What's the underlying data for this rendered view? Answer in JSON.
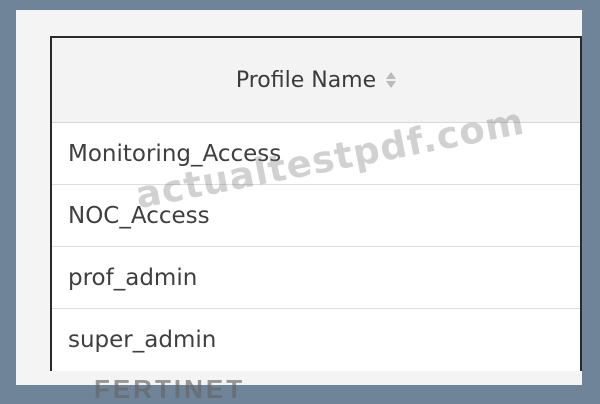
{
  "table": {
    "header": "Profile Name",
    "sort_icon": "sort-updown-icon",
    "rows": [
      "Monitoring_Access",
      "NOC_Access",
      "prof_admin",
      "super_admin"
    ]
  },
  "watermark": "actualtestpdf.com",
  "footer_logo": "FERTINET",
  "colors": {
    "background": "#6f8399",
    "panel": "#f4f4f4",
    "border": "#2a2a2a",
    "header": "#f3f3f3",
    "text": "#3f3f3f"
  }
}
